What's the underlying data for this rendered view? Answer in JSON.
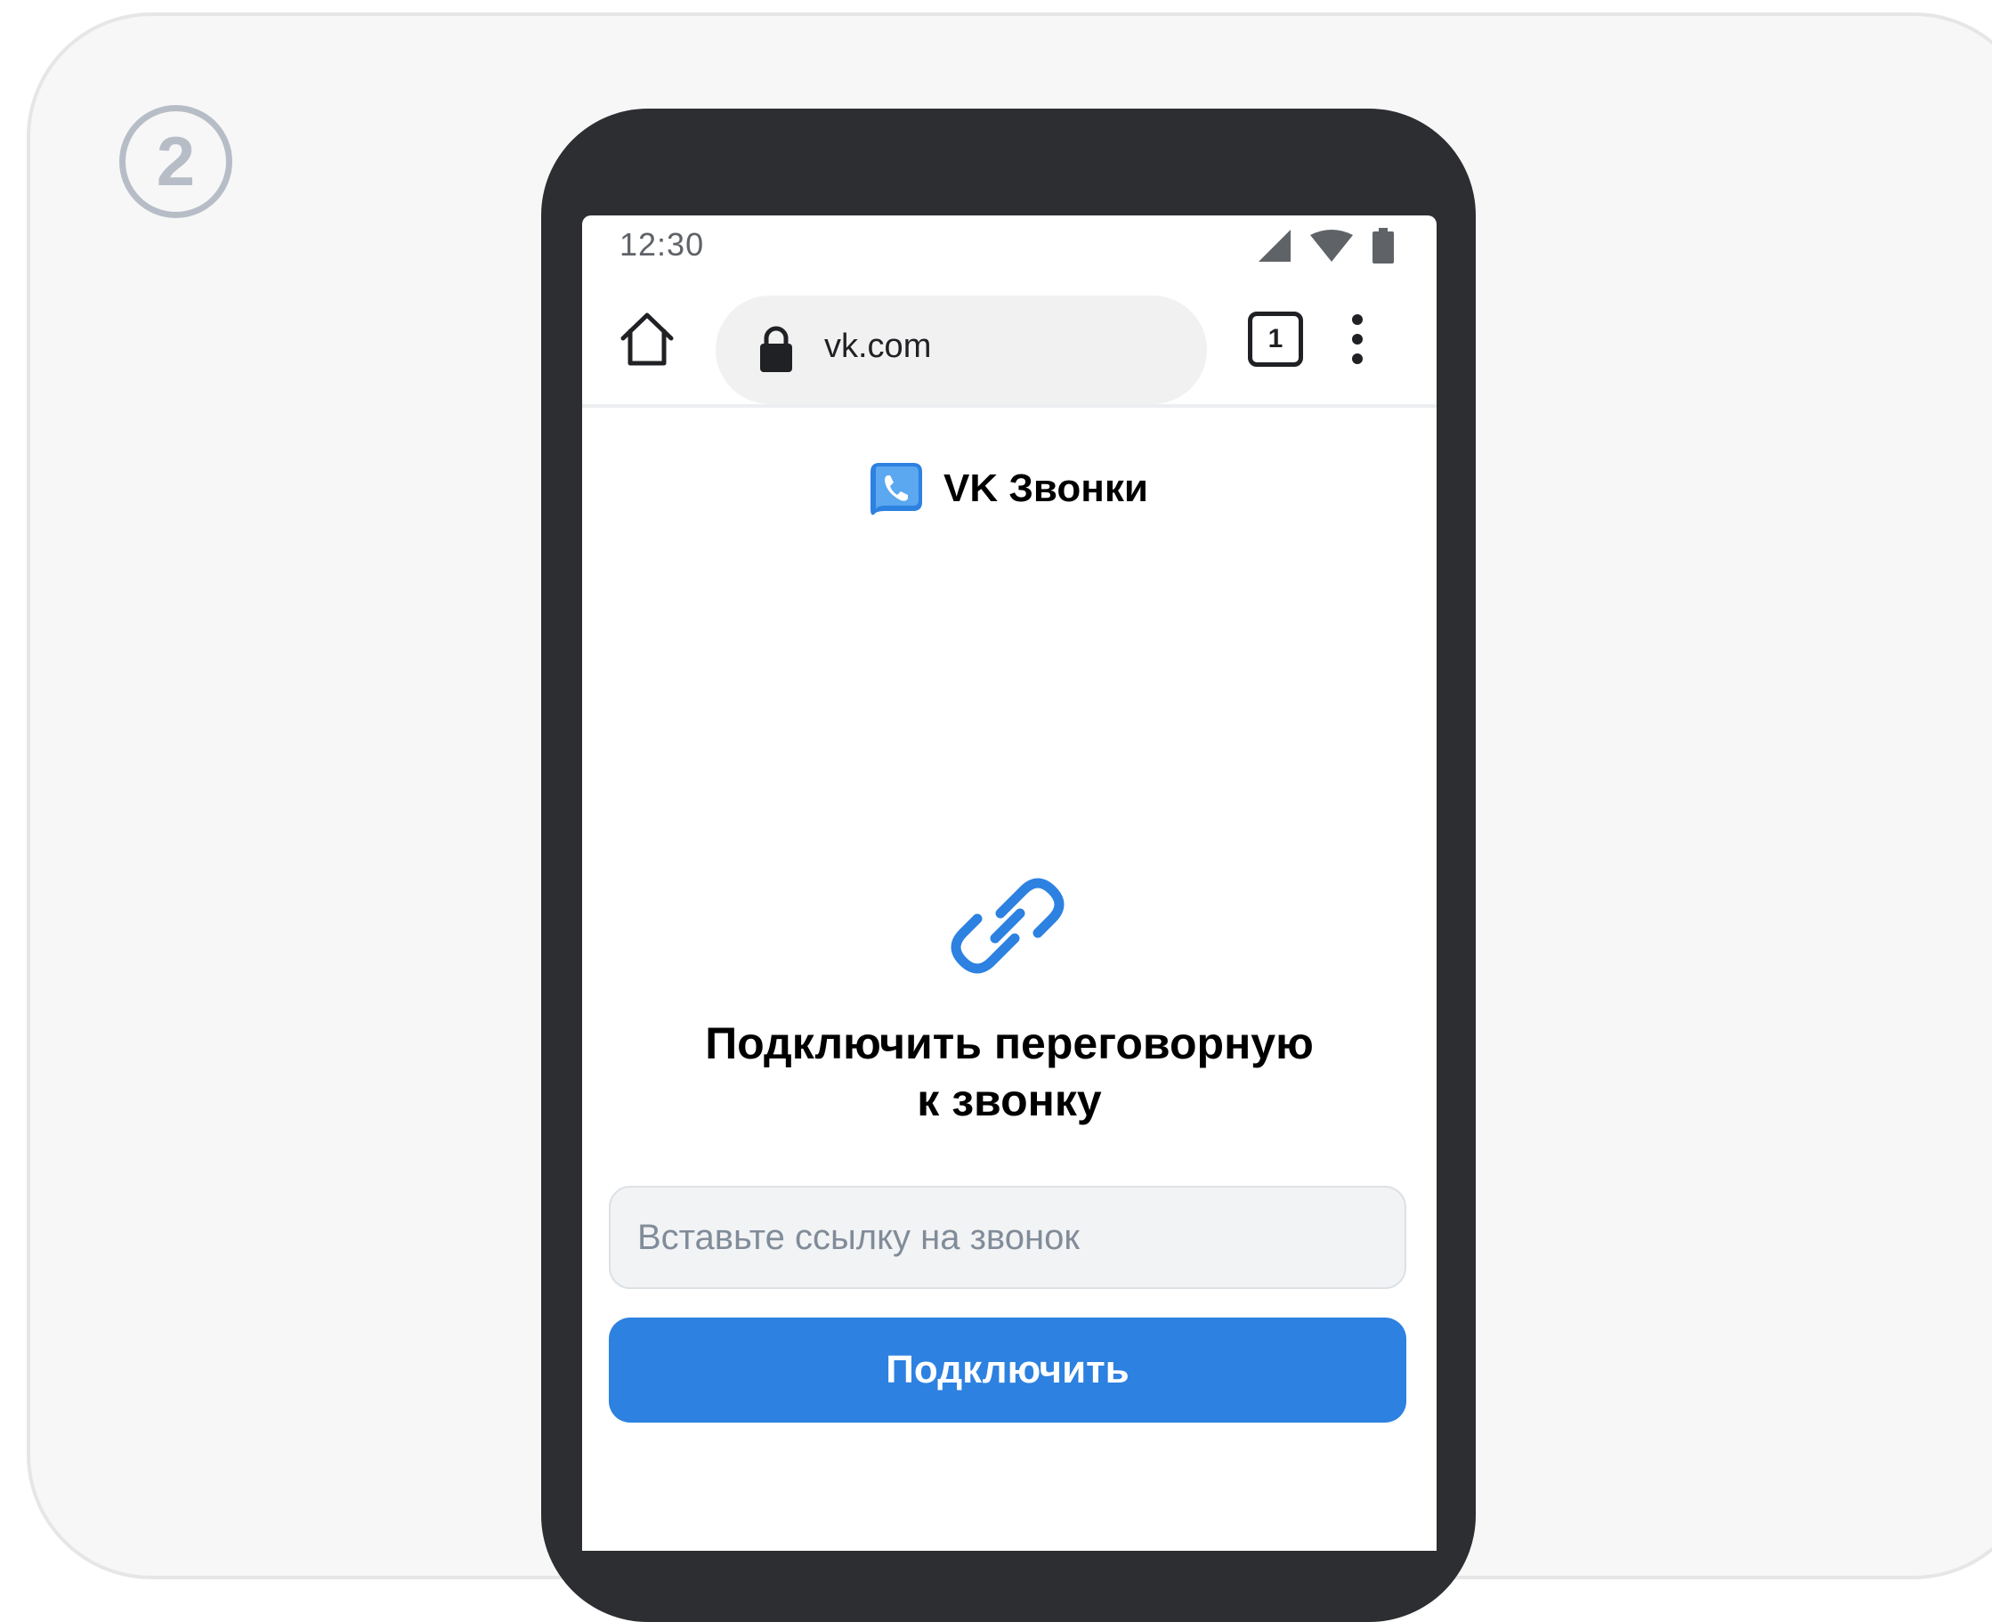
{
  "step": {
    "number": "2"
  },
  "status_bar": {
    "time": "12:30",
    "icons": [
      "signal-icon",
      "wifi-icon",
      "battery-icon"
    ]
  },
  "browser": {
    "url": "vk.com",
    "tab_count": "1",
    "icons": [
      "home-icon",
      "lock-icon",
      "more-vert-icon"
    ]
  },
  "app": {
    "name": "VK Звонки",
    "brand_color": "#2d81e0"
  },
  "main": {
    "icon": "link-icon",
    "title_line1": "Подключить переговорную",
    "title_line2": "к звонку",
    "input_placeholder": "Вставьте ссылку на звонок",
    "input_value": "",
    "button_label": "Подключить"
  }
}
